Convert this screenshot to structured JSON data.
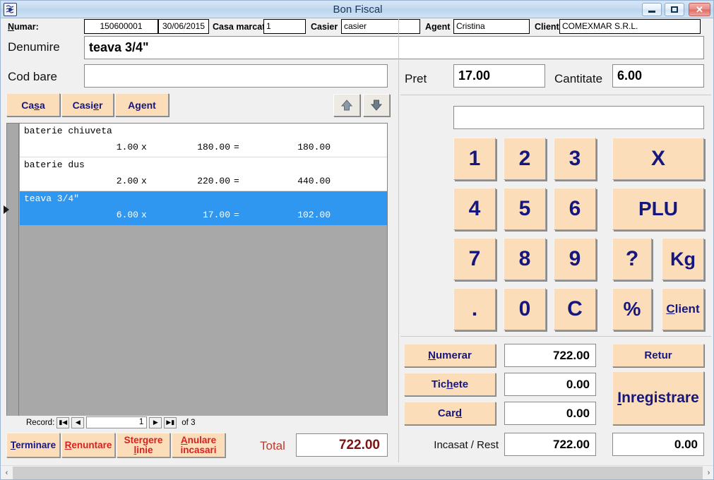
{
  "window": {
    "title": "Bon Fiscal",
    "icon": "app-icon",
    "minimize": "minimize-icon",
    "maximize": "maximize-icon",
    "close": "✕"
  },
  "header": {
    "numar_label": "Numar:",
    "numar_value": "150600001",
    "data_value": "30/06/2015",
    "casa_marcat_label": "Casa marcat",
    "casa_marcat_value": "1",
    "casier_label": "Casier",
    "casier_value": "casier",
    "agent_label": "Agent",
    "agent_value": "Cristina",
    "client_label": "Client",
    "client_value": "COMEXMAR S.R.L."
  },
  "left": {
    "denumire_label": "Denumire",
    "denumire_value": "teava 3/4\"",
    "codbare_label": "Cod bare",
    "codbare_value": "",
    "btn_casa": "Casa",
    "btn_casier": "Casier",
    "btn_agent": "Agent",
    "arrow_up": "up-arrow-icon",
    "arrow_down": "down-arrow-icon"
  },
  "grid": {
    "rows": [
      {
        "name": "baterie chiuveta",
        "qty": "1.00",
        "x": "x",
        "price": "180.00",
        "eq": "=",
        "total": "180.00",
        "selected": false
      },
      {
        "name": "baterie dus",
        "qty": "2.00",
        "x": "x",
        "price": "220.00",
        "eq": "=",
        "total": "440.00",
        "selected": false
      },
      {
        "name": "teava 3/4\"",
        "qty": "6.00",
        "x": "x",
        "price": "17.00",
        "eq": "=",
        "total": "102.00",
        "selected": true
      }
    ]
  },
  "recordnav": {
    "label": "Record:",
    "first": "▮◀",
    "prev": "◀",
    "current": "1",
    "next": "▶",
    "last": "▶▮",
    "of": "of 3"
  },
  "right": {
    "pret_label": "Pret",
    "pret_value": "17.00",
    "cantitate_label": "Cantitate",
    "cantitate_value": "6.00",
    "entry_value": ""
  },
  "keypad": [
    {
      "label": "1",
      "name": "key-1"
    },
    {
      "label": "2",
      "name": "key-2"
    },
    {
      "label": "3",
      "name": "key-3"
    },
    {
      "label": "X",
      "name": "key-multiply"
    },
    {
      "label": "4",
      "name": "key-4"
    },
    {
      "label": "5",
      "name": "key-5"
    },
    {
      "label": "6",
      "name": "key-6"
    },
    {
      "label": "PLU",
      "name": "key-plu"
    },
    {
      "label": "7",
      "name": "key-7"
    },
    {
      "label": "8",
      "name": "key-8"
    },
    {
      "label": "9",
      "name": "key-9"
    },
    {
      "label": "?",
      "name": "key-question"
    },
    {
      "label": "Kg",
      "name": "key-kg"
    },
    {
      "label": ".",
      "name": "key-dot"
    },
    {
      "label": "0",
      "name": "key-0"
    },
    {
      "label": "C",
      "name": "key-clear"
    },
    {
      "label": "%",
      "name": "key-percent"
    },
    {
      "label": "Client",
      "name": "key-client"
    }
  ],
  "payment": {
    "numerar_label": "Numerar",
    "numerar_value": "722.00",
    "tichete_label": "Tichete",
    "tichete_value": "0.00",
    "card_label": "Card",
    "card_value": "0.00",
    "retur_label": "Retur",
    "inregistrare_label": "Inregistrare",
    "incasat_rest_label": "Incasat / Rest",
    "incasat_value": "722.00",
    "rest_value": "0.00"
  },
  "actions": {
    "terminare": "Terminare",
    "renuntare": "Renuntare",
    "stergere_linie_1": "Stergere",
    "stergere_linie_2": "linie",
    "anulare_incasari_1": "Anulare",
    "anulare_incasari_2": "incasari",
    "total_label": "Total",
    "total_value": "722.00"
  },
  "scrollbar": {
    "left_arrow": "‹",
    "right_arrow": "›"
  },
  "colors": {
    "button_tan": "#fbddb9",
    "button_text": "#16177e",
    "selection_blue": "#2f97f0",
    "total_red": "#7b1515",
    "grid_empty": "#a8a8a8"
  }
}
